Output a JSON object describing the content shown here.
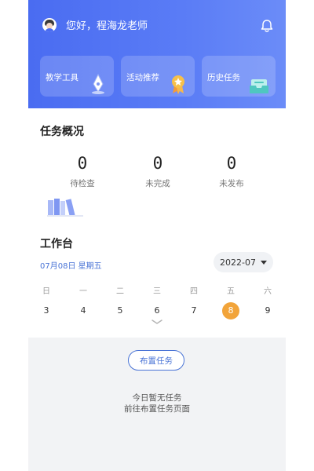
{
  "header": {
    "greeting": "您好，程海龙老师",
    "cards": [
      {
        "label": "教学工具",
        "icon": "pen-nib-icon"
      },
      {
        "label": "活动推荐",
        "icon": "medal-icon"
      },
      {
        "label": "历史任务",
        "icon": "tray-icon"
      }
    ]
  },
  "overview": {
    "title": "任务概况",
    "stats": [
      {
        "value": "0",
        "label": "待检查"
      },
      {
        "value": "0",
        "label": "未完成"
      },
      {
        "value": "0",
        "label": "未发布"
      }
    ]
  },
  "workbench": {
    "title": "工作台",
    "date": "07月08日 星期五",
    "month": "2022-07",
    "weekdays": [
      "日",
      "一",
      "二",
      "三",
      "四",
      "五",
      "六"
    ],
    "days": [
      "3",
      "4",
      "5",
      "6",
      "7",
      "8",
      "9"
    ],
    "selected_day": "8"
  },
  "tasks": {
    "assign_button": "布置任务",
    "empty_line1": "今日暂无任务",
    "empty_line2": "前往布置任务页面"
  },
  "colors": {
    "header_blue": "#4a6cf1",
    "accent_blue": "#4a74d6",
    "selected_orange": "#f2a43a"
  }
}
